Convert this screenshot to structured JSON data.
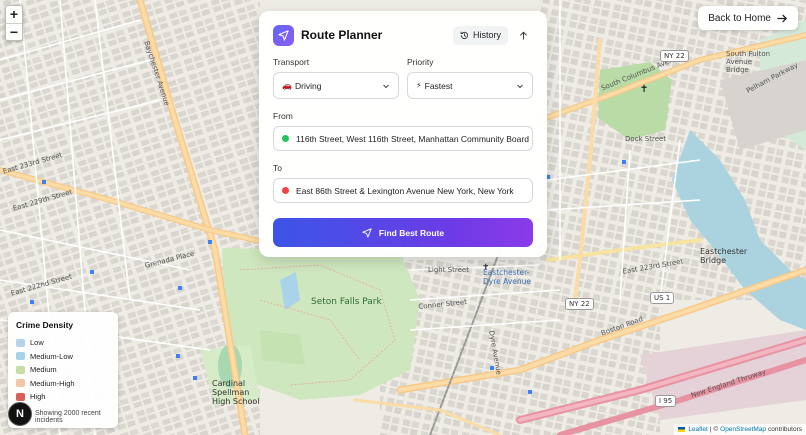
{
  "map": {
    "zoom_in": "+",
    "zoom_out": "−",
    "labels": {
      "seton_falls": "Seton Falls Park",
      "eastchester_dyre": "Eastchester-Dyre Avenue",
      "eastchester_bridge": "Eastchester Bridge",
      "south_fulton": "South Fulton Avenue Bridge",
      "cardinal": "Cardinal Spellman High School",
      "bay_parkway": "Baychester Avenue",
      "boston_road": "Boston Road",
      "light_street": "Light Street",
      "dock_street": "Dock Street",
      "east_233": "East 233rd Street",
      "east_229": "East 229th Street",
      "east_222": "East 222nd Street",
      "east_223": "East 223rd Street",
      "pelham": "Pelham Parkway",
      "new_england": "New England Thruway",
      "columbus": "South Columbus Avenue",
      "conner": "Conner Street",
      "grenada": "Grenada Place",
      "dyre": "Dyre Avenue",
      "ny22": "NY 22",
      "us1": "US 1",
      "i95": "I 95"
    }
  },
  "back_button": {
    "label": "Back to Home"
  },
  "planner": {
    "title": "Route Planner",
    "history_label": "History",
    "transport": {
      "label": "Transport",
      "emoji": "🚗",
      "value": "Driving"
    },
    "priority": {
      "label": "Priority",
      "emoji": "⚡",
      "value": "Fastest"
    },
    "from": {
      "label": "From",
      "value": "116th Street, West 116th Street, Manhattan Community Board 10"
    },
    "to": {
      "label": "To",
      "value": "East 86th Street & Lexington Avenue New York, New York"
    },
    "find_button": "Find Best Route"
  },
  "legend": {
    "title": "Crime Density",
    "items": [
      {
        "label": "Low",
        "color": "#b3d4ec"
      },
      {
        "label": "Medium-Low",
        "color": "#a9d4e8"
      },
      {
        "label": "Medium",
        "color": "#c6dea3"
      },
      {
        "label": "Medium-High",
        "color": "#f2c6a8"
      },
      {
        "label": "High",
        "color": "#d9605a"
      }
    ],
    "note": "Showing 2000 recent incidents"
  },
  "logo": {
    "letter": "N"
  },
  "attribution": {
    "leaflet": "Leaflet",
    "sep": "| ©",
    "osm": "OpenStreetMap",
    "contrib": "contributors"
  }
}
